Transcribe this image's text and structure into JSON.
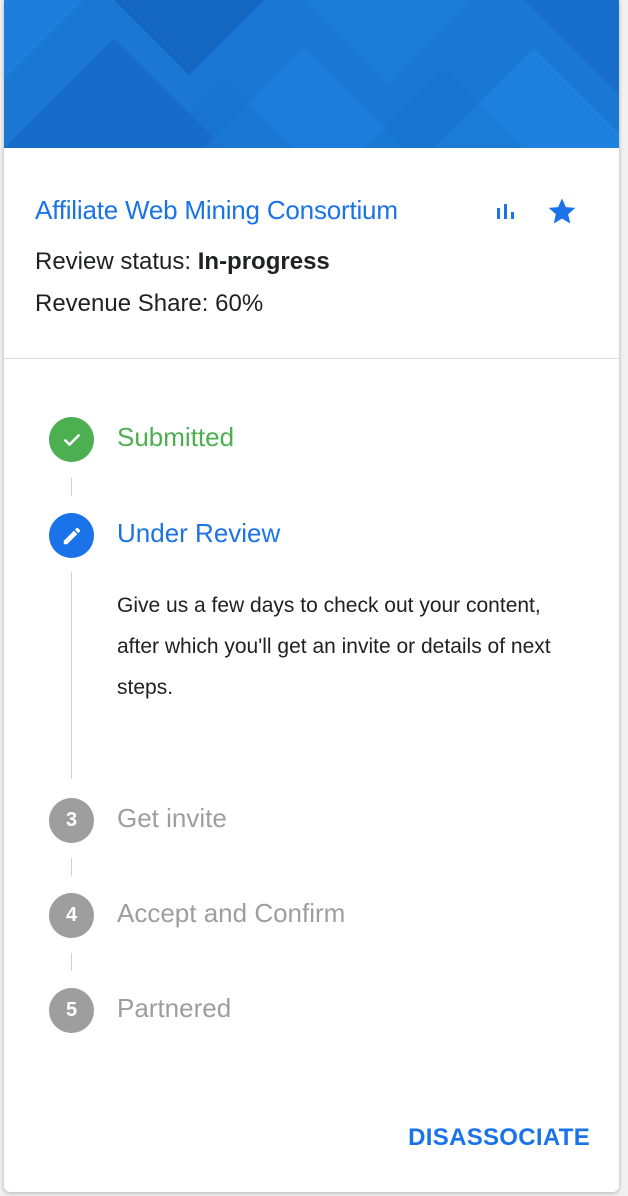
{
  "card": {
    "title": "Affiliate Web Mining Consortium",
    "status_label": "Review status: ",
    "status_value": "In-progress",
    "share_text": "Revenue Share: 60%",
    "icons": {
      "stats": "bar-chart-icon",
      "favorite": "star-icon"
    }
  },
  "steps": [
    {
      "marker": "",
      "label": "Submitted",
      "state": "done",
      "icon": "check-icon"
    },
    {
      "marker": "",
      "label": "Under Review",
      "state": "active",
      "icon": "pencil-icon",
      "description": "Give us a few days to check out your content, after which you'll get an invite or details of next steps."
    },
    {
      "marker": "3",
      "label": "Get invite",
      "state": "pending"
    },
    {
      "marker": "4",
      "label": "Accept and Confirm",
      "state": "pending"
    },
    {
      "marker": "5",
      "label": "Partnered",
      "state": "pending"
    }
  ],
  "actions": {
    "disassociate_label": "DISASSOCIATE"
  },
  "colors": {
    "accent": "#1a73e8",
    "banner": "#1a75d2",
    "done": "#4caf50",
    "pending": "#9e9e9e"
  }
}
